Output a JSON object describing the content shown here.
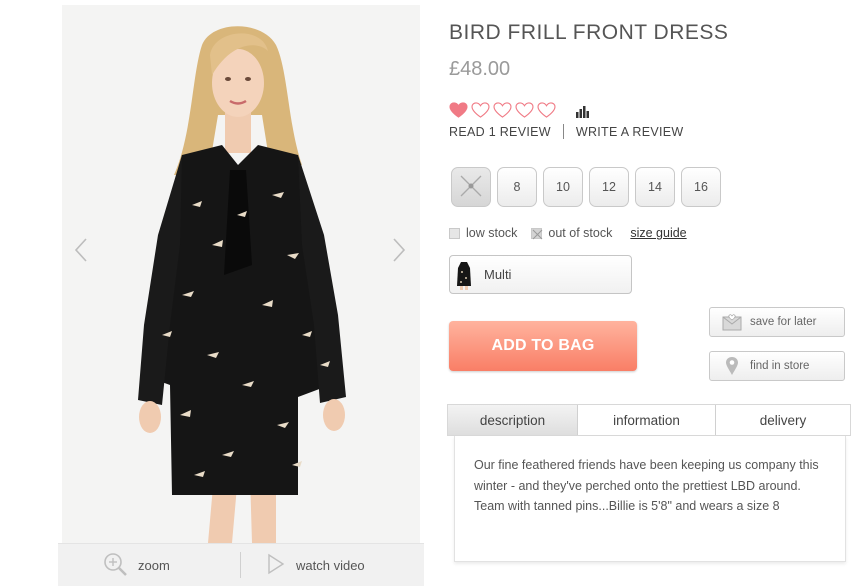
{
  "gallery": {
    "zoom_label": "zoom",
    "video_label": "watch video"
  },
  "product": {
    "title": "BIRD FRILL FRONT DRESS",
    "price": "£48.00",
    "rating": {
      "value": 1,
      "max": 5
    },
    "read_reviews": "READ 1 REVIEW",
    "write_review": "WRITE A REVIEW"
  },
  "sizes": [
    {
      "label": "",
      "out_of_stock": true
    },
    {
      "label": "8",
      "out_of_stock": false
    },
    {
      "label": "10",
      "out_of_stock": false
    },
    {
      "label": "12",
      "out_of_stock": false
    },
    {
      "label": "14",
      "out_of_stock": false
    },
    {
      "label": "16",
      "out_of_stock": false
    }
  ],
  "stock_legend": {
    "low": "low stock",
    "out": "out of stock",
    "size_guide": "size guide"
  },
  "colour": {
    "selected": "Multi"
  },
  "actions": {
    "add_to_bag": "ADD TO BAG",
    "save_for_later": "save for later",
    "find_in_store": "find in store"
  },
  "tabs": [
    {
      "label": "description",
      "active": true
    },
    {
      "label": "information",
      "active": false
    },
    {
      "label": "delivery",
      "active": false
    }
  ],
  "description": "Our fine feathered friends have been keeping us company this winter - and they've perched onto the prettiest LBD around. Team with tanned pins...Billie is 5'8\" and wears a size 8",
  "colors": {
    "accent": "#f97e66",
    "heart": "#f07a85",
    "title_grey": "#555555"
  }
}
